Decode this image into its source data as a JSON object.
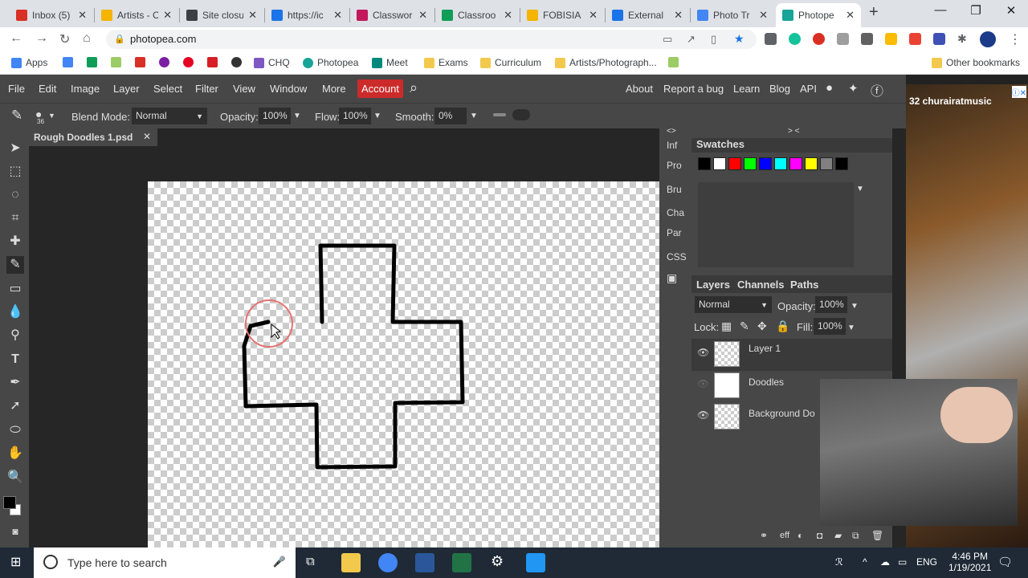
{
  "browser": {
    "tabs": [
      {
        "title": "Inbox (5)",
        "color": "#d93025"
      },
      {
        "title": "Artists - C",
        "color": "#f4b400"
      },
      {
        "title": "Site closu",
        "color": "#3c4043"
      },
      {
        "title": "https://ic",
        "color": "#1a73e8"
      },
      {
        "title": "Classwor",
        "color": "#c2185b"
      },
      {
        "title": "Classroo",
        "color": "#0f9d58"
      },
      {
        "title": "FOBISIA",
        "color": "#f4b400"
      },
      {
        "title": "External",
        "color": "#1a73e8"
      },
      {
        "title": "Photo Tr",
        "color": "#4285f4"
      },
      {
        "title": "Photope",
        "color": "#18a497"
      }
    ],
    "url": "photopea.com",
    "bookmarks": [
      {
        "label": "Apps"
      },
      {
        "label": "CHQ"
      },
      {
        "label": "Photopea"
      },
      {
        "label": "Meet"
      },
      {
        "label": "Exams"
      },
      {
        "label": "Curriculum"
      },
      {
        "label": "Artists/Photograph..."
      }
    ],
    "other_bookmarks": "Other bookmarks"
  },
  "menu": [
    "File",
    "Edit",
    "Image",
    "Layer",
    "Select",
    "Filter",
    "View",
    "Window",
    "More"
  ],
  "account": "Account",
  "right_menu": [
    "About",
    "Report a bug",
    "Learn",
    "Blog",
    "API"
  ],
  "options": {
    "brush_size": "36",
    "blend_label": "Blend Mode:",
    "blend_value": "Normal",
    "opacity_label": "Opacity:",
    "opacity_value": "100%",
    "flow_label": "Flow:",
    "flow_value": "100%",
    "smooth_label": "Smooth:",
    "smooth_value": "0%"
  },
  "document": {
    "tab_title": "Rough Doodles 1.psd"
  },
  "side_panels": [
    "Inf",
    "Pro",
    "Bru",
    "Cha",
    "Par",
    "CSS"
  ],
  "swatches": {
    "title": "Swatches",
    "colors": [
      "#000000",
      "#ffffff",
      "#ff0000",
      "#00ff00",
      "#0000ff",
      "#00ffff",
      "#ff00ff",
      "#ffff00",
      "#808080",
      "#000000"
    ]
  },
  "layers_panel": {
    "tabs": [
      "Layers",
      "Channels",
      "Paths"
    ],
    "blend": "Normal",
    "opacity_label": "Opacity:",
    "opacity": "100%",
    "lock_label": "Lock:",
    "fill_label": "Fill:",
    "fill": "100%",
    "layers": [
      {
        "name": "Layer 1"
      },
      {
        "name": "Doodles"
      },
      {
        "name": "Background Do"
      }
    ]
  },
  "ad": {
    "brand": "32 churairatmusic"
  },
  "taskbar": {
    "search_placeholder": "Type here to search",
    "lang": "ENG",
    "time": "4:46 PM",
    "date": "1/19/2021"
  }
}
